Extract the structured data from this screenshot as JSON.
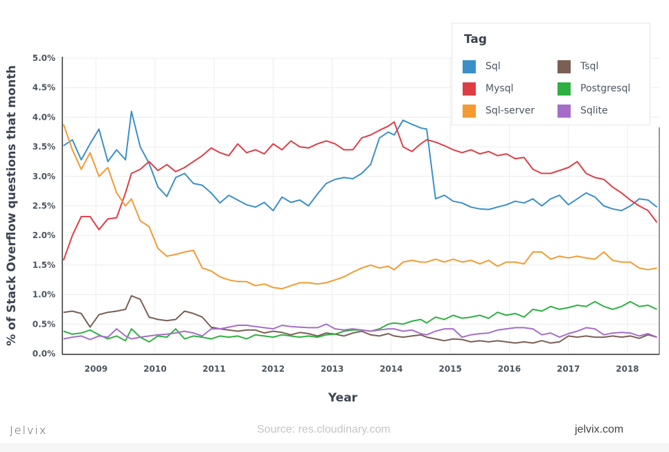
{
  "chart_data": {
    "type": "line",
    "title": "",
    "xlabel": "Year",
    "ylabel": "% of Stack Overflow questions that month",
    "xlim": [
      2008.43,
      2018.54
    ],
    "ylim": [
      0,
      5.0
    ],
    "grid": true,
    "legend_title": "Tag",
    "legend_position": "top-right",
    "x_ticks": [
      2009,
      2010,
      2011,
      2012,
      2013,
      2014,
      2015,
      2016,
      2017,
      2018
    ],
    "x_tick_labels": [
      "2009",
      "2010",
      "2011",
      "2012",
      "2013",
      "2014",
      "2015",
      "2016",
      "2017",
      "2018"
    ],
    "y_ticks": [
      0,
      0.5,
      1.0,
      1.5,
      2.0,
      2.5,
      3.0,
      3.5,
      4.0,
      4.5,
      5.0
    ],
    "y_tick_labels": [
      "0.0%",
      "0.5%",
      "1.0%",
      "1.5%",
      "2.0%",
      "2.5%",
      "3.0%",
      "3.5%",
      "4.0%",
      "4.5%",
      "5.0%"
    ],
    "x": [
      2008.45,
      2008.6,
      2008.75,
      2008.9,
      2009.05,
      2009.2,
      2009.35,
      2009.5,
      2009.6,
      2009.75,
      2009.9,
      2010.05,
      2010.2,
      2010.35,
      2010.5,
      2010.65,
      2010.8,
      2010.95,
      2011.1,
      2011.25,
      2011.4,
      2011.55,
      2011.7,
      2011.85,
      2012.0,
      2012.15,
      2012.3,
      2012.45,
      2012.6,
      2012.75,
      2012.9,
      2013.05,
      2013.2,
      2013.35,
      2013.5,
      2013.65,
      2013.8,
      2013.95,
      2014.05,
      2014.2,
      2014.35,
      2014.5,
      2014.6,
      2014.75,
      2014.9,
      2015.05,
      2015.2,
      2015.35,
      2015.5,
      2015.65,
      2015.8,
      2015.95,
      2016.1,
      2016.25,
      2016.4,
      2016.55,
      2016.7,
      2016.85,
      2017.0,
      2017.15,
      2017.3,
      2017.45,
      2017.6,
      2017.75,
      2017.9,
      2018.05,
      2018.2,
      2018.35,
      2018.5
    ],
    "series": [
      {
        "name": "Sql",
        "color": "#3a8fc8",
        "values": [
          3.52,
          3.62,
          3.28,
          3.55,
          3.8,
          3.25,
          3.45,
          3.28,
          4.1,
          3.5,
          3.22,
          2.82,
          2.66,
          2.98,
          3.05,
          2.88,
          2.85,
          2.72,
          2.55,
          2.68,
          2.6,
          2.52,
          2.48,
          2.56,
          2.42,
          2.65,
          2.56,
          2.6,
          2.5,
          2.7,
          2.88,
          2.95,
          2.98,
          2.96,
          3.05,
          3.2,
          3.65,
          3.75,
          3.7,
          3.95,
          3.88,
          3.82,
          3.8,
          2.62,
          2.68,
          2.58,
          2.55,
          2.48,
          2.45,
          2.44,
          2.48,
          2.52,
          2.58,
          2.55,
          2.62,
          2.5,
          2.62,
          2.68,
          2.52,
          2.62,
          2.72,
          2.65,
          2.5,
          2.45,
          2.42,
          2.5,
          2.62,
          2.6,
          2.48
        ]
      },
      {
        "name": "Mysql",
        "color": "#e03c44",
        "values": [
          1.58,
          2.0,
          2.32,
          2.32,
          2.1,
          2.28,
          2.3,
          2.72,
          3.05,
          3.12,
          3.25,
          3.1,
          3.2,
          3.08,
          3.15,
          3.25,
          3.35,
          3.48,
          3.4,
          3.35,
          3.55,
          3.4,
          3.45,
          3.38,
          3.55,
          3.45,
          3.6,
          3.5,
          3.48,
          3.55,
          3.6,
          3.55,
          3.45,
          3.45,
          3.65,
          3.7,
          3.78,
          3.85,
          3.92,
          3.5,
          3.42,
          3.55,
          3.62,
          3.58,
          3.52,
          3.45,
          3.4,
          3.45,
          3.38,
          3.42,
          3.35,
          3.38,
          3.3,
          3.32,
          3.12,
          3.05,
          3.05,
          3.1,
          3.15,
          3.25,
          3.05,
          2.98,
          2.95,
          2.82,
          2.72,
          2.6,
          2.5,
          2.42,
          2.22
        ]
      },
      {
        "name": "Sql-server",
        "color": "#f39a31",
        "values": [
          3.88,
          3.45,
          3.12,
          3.4,
          3.0,
          3.15,
          2.72,
          2.5,
          2.62,
          2.25,
          2.15,
          1.78,
          1.65,
          1.68,
          1.72,
          1.75,
          1.45,
          1.4,
          1.3,
          1.25,
          1.22,
          1.22,
          1.15,
          1.18,
          1.12,
          1.1,
          1.15,
          1.2,
          1.2,
          1.18,
          1.2,
          1.25,
          1.3,
          1.38,
          1.45,
          1.5,
          1.45,
          1.48,
          1.42,
          1.55,
          1.58,
          1.55,
          1.55,
          1.6,
          1.55,
          1.6,
          1.55,
          1.58,
          1.52,
          1.58,
          1.48,
          1.55,
          1.55,
          1.52,
          1.72,
          1.72,
          1.6,
          1.65,
          1.62,
          1.65,
          1.62,
          1.6,
          1.72,
          1.58,
          1.55,
          1.55,
          1.45,
          1.42,
          1.45
        ]
      },
      {
        "name": "Tsql",
        "color": "#7a5f55",
        "values": [
          0.7,
          0.72,
          0.68,
          0.45,
          0.66,
          0.7,
          0.72,
          0.75,
          0.98,
          0.92,
          0.62,
          0.58,
          0.56,
          0.58,
          0.72,
          0.68,
          0.62,
          0.45,
          0.42,
          0.4,
          0.38,
          0.4,
          0.4,
          0.35,
          0.38,
          0.36,
          0.32,
          0.36,
          0.34,
          0.3,
          0.35,
          0.33,
          0.3,
          0.35,
          0.38,
          0.32,
          0.3,
          0.34,
          0.3,
          0.28,
          0.3,
          0.32,
          0.28,
          0.25,
          0.22,
          0.25,
          0.24,
          0.2,
          0.22,
          0.2,
          0.22,
          0.2,
          0.18,
          0.2,
          0.18,
          0.22,
          0.18,
          0.2,
          0.3,
          0.28,
          0.3,
          0.28,
          0.28,
          0.3,
          0.28,
          0.3,
          0.26,
          0.32,
          0.28
        ]
      },
      {
        "name": "Postgresql",
        "color": "#2db040",
        "values": [
          0.38,
          0.33,
          0.35,
          0.4,
          0.32,
          0.25,
          0.3,
          0.22,
          0.42,
          0.28,
          0.2,
          0.3,
          0.28,
          0.42,
          0.25,
          0.3,
          0.28,
          0.25,
          0.3,
          0.28,
          0.3,
          0.25,
          0.32,
          0.3,
          0.28,
          0.32,
          0.3,
          0.28,
          0.3,
          0.28,
          0.32,
          0.33,
          0.38,
          0.4,
          0.4,
          0.38,
          0.42,
          0.5,
          0.52,
          0.5,
          0.55,
          0.58,
          0.52,
          0.62,
          0.58,
          0.65,
          0.6,
          0.62,
          0.65,
          0.6,
          0.7,
          0.65,
          0.68,
          0.62,
          0.75,
          0.72,
          0.8,
          0.75,
          0.78,
          0.82,
          0.8,
          0.88,
          0.8,
          0.75,
          0.8,
          0.88,
          0.8,
          0.82,
          0.75
        ]
      },
      {
        "name": "Sqlite",
        "color": "#a56dc8",
        "values": [
          0.25,
          0.28,
          0.3,
          0.24,
          0.3,
          0.28,
          0.42,
          0.3,
          0.25,
          0.28,
          0.3,
          0.32,
          0.33,
          0.35,
          0.38,
          0.35,
          0.3,
          0.42,
          0.42,
          0.45,
          0.48,
          0.48,
          0.46,
          0.44,
          0.42,
          0.48,
          0.46,
          0.45,
          0.44,
          0.44,
          0.5,
          0.42,
          0.4,
          0.42,
          0.4,
          0.38,
          0.4,
          0.42,
          0.42,
          0.38,
          0.4,
          0.34,
          0.32,
          0.38,
          0.42,
          0.42,
          0.28,
          0.32,
          0.34,
          0.35,
          0.4,
          0.42,
          0.44,
          0.44,
          0.42,
          0.32,
          0.35,
          0.28,
          0.34,
          0.38,
          0.44,
          0.42,
          0.32,
          0.35,
          0.36,
          0.35,
          0.3,
          0.34,
          0.28
        ]
      }
    ]
  },
  "footer": {
    "brand_left": "Jelvix",
    "source": "Source: res.cloudinary.com",
    "brand_right": "jelvix.com"
  }
}
